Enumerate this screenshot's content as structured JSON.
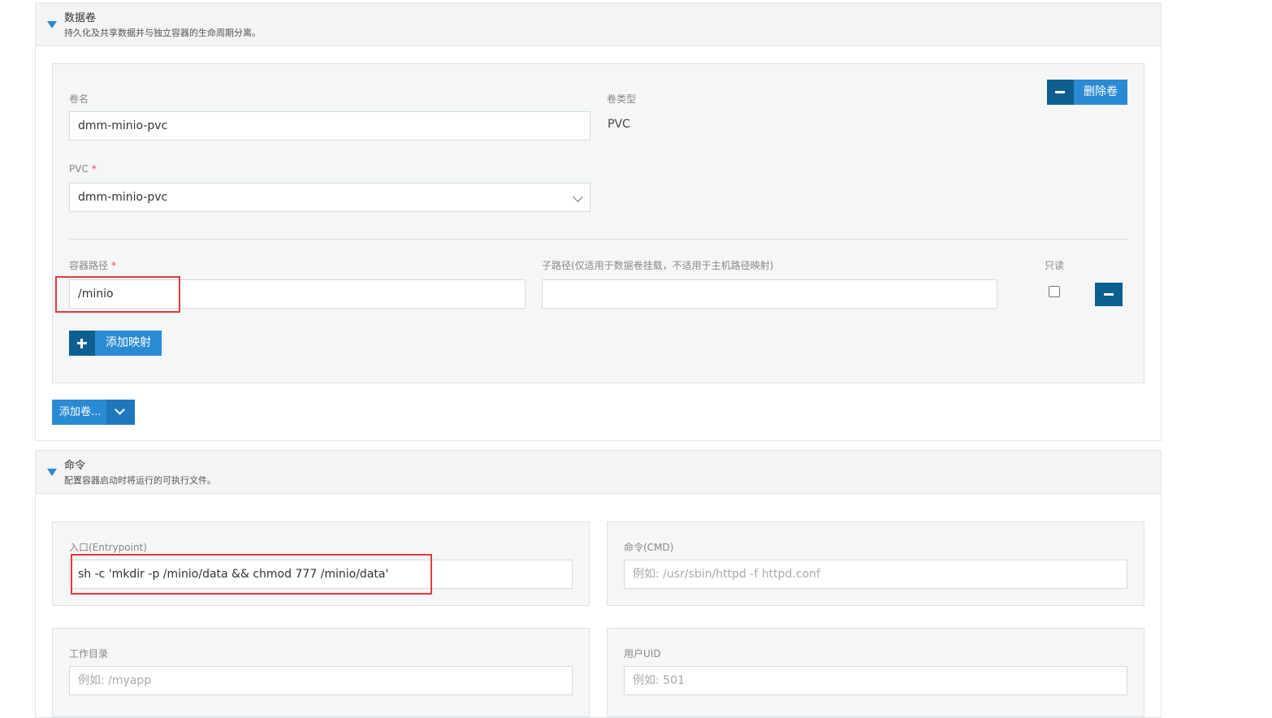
{
  "volumes": {
    "title": "数据卷",
    "description": "持久化及共享数据并与独立容器的生命周期分离。",
    "volume_name_label": "卷名",
    "volume_name_value": "dmm-minio-pvc",
    "volume_type_label": "卷类型",
    "volume_type_value": "PVC",
    "pvc_label": "PVC",
    "pvc_required_mark": "*",
    "pvc_selected": "dmm-minio-pvc",
    "remove_volume_label": "删除卷",
    "mount_path_label": "容器路径",
    "mount_path_required_mark": "*",
    "mount_path_value": "/minio",
    "sub_path_label": "子路径(仅适用于数据卷挂载，不适用于主机路径映射)",
    "sub_path_value": "",
    "read_only_label": "只读",
    "read_only_checked": false,
    "add_mapping_label": "添加映射",
    "add_volume_label": "添加卷..."
  },
  "command": {
    "title": "命令",
    "description": "配置容器启动时将运行的可执行文件。",
    "entrypoint_label": "入口(Entrypoint)",
    "entrypoint_value": "sh -c 'mkdir -p /minio/data && chmod 777 /minio/data'",
    "cmd_label": "命令(CMD)",
    "cmd_placeholder": "例如: /usr/sbin/httpd -f httpd.conf",
    "workdir_label": "工作目录",
    "workdir_placeholder": "例如: /myapp",
    "uid_label": "用户UID",
    "uid_placeholder": "例如: 501"
  },
  "colors": {
    "accent": "#2a8ad4",
    "accent_dark": "#0d5f8f",
    "highlight": "#e23a3a"
  }
}
